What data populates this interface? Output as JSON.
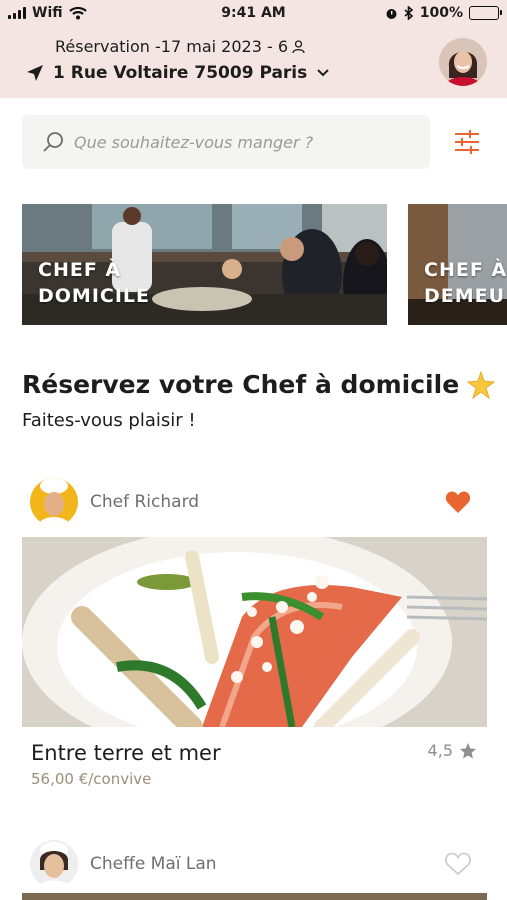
{
  "status_bar": {
    "carrier": "Wifi",
    "time": "9:41 AM",
    "battery": "100%"
  },
  "header": {
    "reservation": "Réservation -17 mai 2023 - 6",
    "address": "1 Rue Voltaire 75009 Paris"
  },
  "search": {
    "placeholder": "Que souhaitez-vous manger ?"
  },
  "categories": [
    {
      "line1": "CHEF À",
      "line2": "DOMICILE"
    },
    {
      "line1": "CHEF À",
      "line2": "DEMEU"
    }
  ],
  "section": {
    "title": "Réservez votre Chef à domicile",
    "subtitle": "Faites-vous plaisir !"
  },
  "chefs": [
    {
      "name": "Chef Richard",
      "favorite": true,
      "dish": {
        "title": "Entre terre et mer",
        "price": "56,00 €/convive",
        "rating": "4,5"
      }
    },
    {
      "name": "Cheffe Maï Lan",
      "favorite": false
    }
  ],
  "colors": {
    "accent": "#e8652f",
    "header_bg": "#f4e5e3"
  }
}
